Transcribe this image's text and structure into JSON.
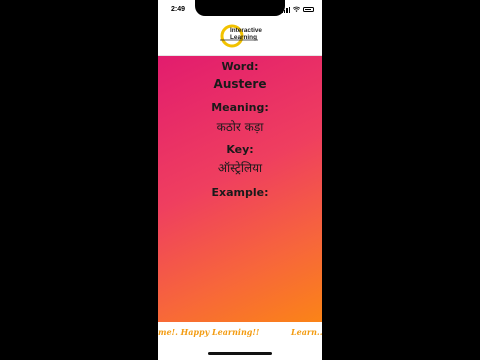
{
  "status_bar": {
    "time": "2:49"
  },
  "header": {
    "logo_line1": "Interactive",
    "logo_line2": "Learning",
    "logo_color": "#f2c200"
  },
  "card": {
    "word_label": "Word:",
    "word_value": "Austere",
    "meaning_label": "Meaning:",
    "meaning_value": "कठोर कड़ा",
    "key_label": "Key:",
    "key_value": "ऑस्ट्रेलिया",
    "example_label": "Example:",
    "gradient_start": "#e21c6e",
    "gradient_end": "#fb8417"
  },
  "footer": {
    "marquee_text": "me!. Happy Learning!!",
    "marquee_trail": "Learn..."
  }
}
